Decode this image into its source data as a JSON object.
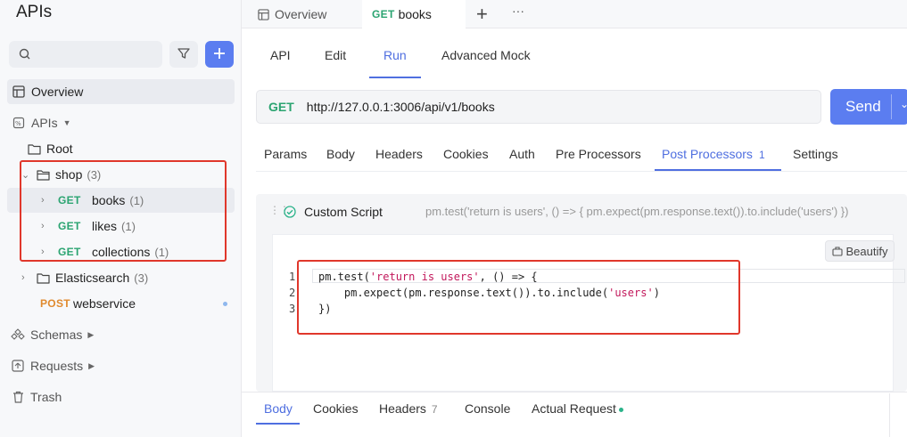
{
  "app": {
    "title": "APIs"
  },
  "sidebar": {
    "overview": "Overview",
    "apis": "APIs",
    "root": "Root",
    "shop": {
      "label": "shop",
      "count": "(3)"
    },
    "shop_items": [
      {
        "method": "GET",
        "name": "books",
        "count": "(1)"
      },
      {
        "method": "GET",
        "name": "likes",
        "count": "(1)"
      },
      {
        "method": "GET",
        "name": "collections",
        "count": "(1)"
      }
    ],
    "elasticsearch": {
      "label": "Elasticsearch",
      "count": "(3)"
    },
    "webservice": {
      "method": "POST",
      "name": "webservice"
    },
    "schemas": "Schemas",
    "requests": "Requests",
    "trash": "Trash"
  },
  "tabs": {
    "overview": "Overview",
    "active_method": "GET",
    "active_name": "books",
    "add": "+",
    "more": "···"
  },
  "subtabs": [
    "API",
    "Edit",
    "Run",
    "Advanced Mock"
  ],
  "request": {
    "method": "GET",
    "url": "http://127.0.0.1:3006/api/v1/books",
    "send": "Send"
  },
  "req_tabs": {
    "params": "Params",
    "body": "Body",
    "headers": "Headers",
    "cookies": "Cookies",
    "auth": "Auth",
    "pre": "Pre Processors",
    "post": "Post Processors",
    "post_count": "1",
    "settings": "Settings"
  },
  "script": {
    "title": "Custom Script",
    "preview": "pm.test('return is users', () => { pm.expect(pm.response.text()).to.include('users') })",
    "beautify": "Beautify",
    "lines": {
      "l1_a": "pm.test(",
      "l1_str": "'return is users'",
      "l1_b": ", () => {",
      "l2_a": "    pm.expect(pm.response.text()).to.include(",
      "l2_str": "'users'",
      "l2_b": ")",
      "l3": "})"
    },
    "numbers": [
      "1",
      "2",
      "3"
    ]
  },
  "response_tabs": {
    "body": "Body",
    "cookies": "Cookies",
    "headers": "Headers",
    "headers_count": "7",
    "console": "Console",
    "actual": "Actual Request"
  },
  "colors": {
    "accent": "#4f6fe0",
    "get": "#2ba471",
    "post": "#e08a2e",
    "highlight_box": "#e0372b"
  }
}
